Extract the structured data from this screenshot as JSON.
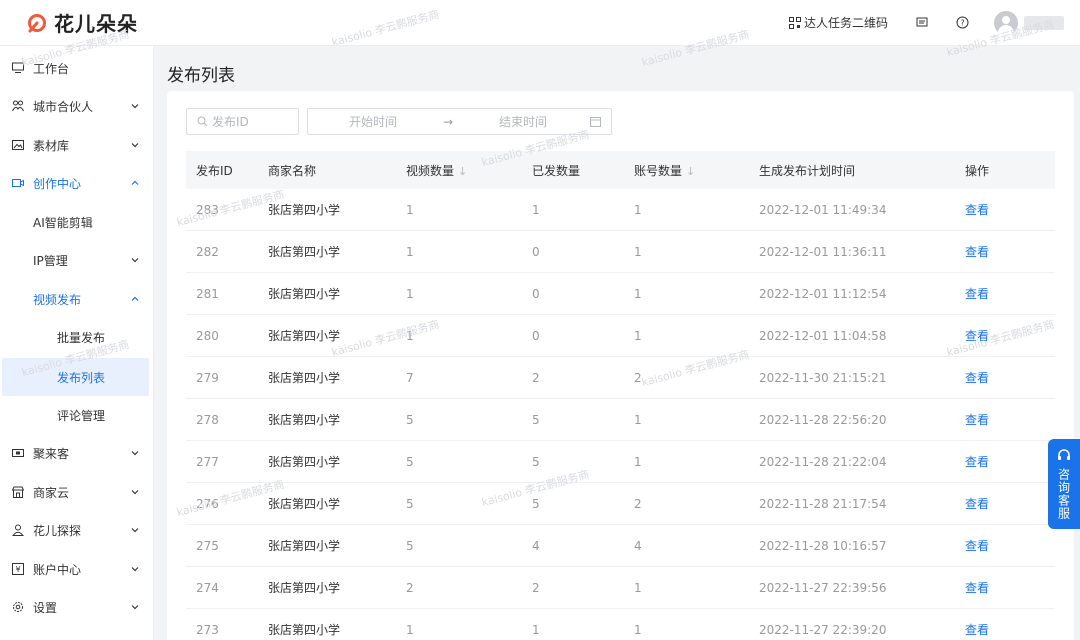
{
  "brand": {
    "name": "花儿朵朵",
    "color": "#f05a3c"
  },
  "header": {
    "qr_label": "达人任务二维码",
    "icons": [
      "qr-icon",
      "message-icon",
      "help-icon"
    ]
  },
  "sidebar": {
    "items": [
      {
        "label": "工作台",
        "icon": "monitor-icon"
      },
      {
        "label": "城市合伙人",
        "icon": "partners-icon"
      },
      {
        "label": "素材库",
        "icon": "image-icon"
      },
      {
        "label": "创作中心",
        "icon": "video-icon"
      },
      {
        "label": "AI智能剪辑"
      },
      {
        "label": "IP管理"
      },
      {
        "label": "视频发布"
      },
      {
        "label": "批量发布"
      },
      {
        "label": "发布列表"
      },
      {
        "label": "评论管理"
      },
      {
        "label": "聚来客",
        "icon": "ticket-icon"
      },
      {
        "label": "商家云",
        "icon": "store-icon"
      },
      {
        "label": "花儿探探",
        "icon": "explore-icon"
      },
      {
        "label": "账户中心",
        "icon": "account-icon"
      },
      {
        "label": "设置",
        "icon": "settings-icon"
      }
    ]
  },
  "main": {
    "title": "发布列表",
    "search_placeholder": "发布ID",
    "date_start_placeholder": "开始时间",
    "date_arrow": "→",
    "date_end_placeholder": "结束时间",
    "columns": [
      "发布ID",
      "商家名称",
      "视频数量",
      "已发数量",
      "账号数量",
      "生成发布计划时间",
      "操作"
    ],
    "sort_symbol": "↓",
    "rows": [
      [
        "283",
        "张店第四小学",
        "1",
        "1",
        "1",
        "2022-12-01 11:49:34",
        "查看"
      ],
      [
        "282",
        "张店第四小学",
        "1",
        "0",
        "1",
        "2022-12-01 11:36:11",
        "查看"
      ],
      [
        "281",
        "张店第四小学",
        "1",
        "0",
        "1",
        "2022-12-01 11:12:54",
        "查看"
      ],
      [
        "280",
        "张店第四小学",
        "1",
        "0",
        "1",
        "2022-12-01 11:04:58",
        "查看"
      ],
      [
        "279",
        "张店第四小学",
        "7",
        "2",
        "2",
        "2022-11-30 21:15:21",
        "查看"
      ],
      [
        "278",
        "张店第四小学",
        "5",
        "5",
        "1",
        "2022-11-28 22:56:20",
        "查看"
      ],
      [
        "277",
        "张店第四小学",
        "5",
        "5",
        "1",
        "2022-11-28 21:22:04",
        "查看"
      ],
      [
        "276",
        "张店第四小学",
        "5",
        "5",
        "2",
        "2022-11-28 21:17:54",
        "查看"
      ],
      [
        "275",
        "张店第四小学",
        "5",
        "4",
        "4",
        "2022-11-28 10:16:57",
        "查看"
      ],
      [
        "274",
        "张店第四小学",
        "2",
        "2",
        "1",
        "2022-11-27 22:39:56",
        "查看"
      ],
      [
        "273",
        "张店第四小学",
        "1",
        "1",
        "1",
        "2022-11-27 22:39:20",
        "查看"
      ]
    ]
  },
  "float_service": {
    "label": "咨询客服",
    "icon": "headset-icon"
  },
  "watermark": "kaisolio 李云鹏服务商",
  "colors": {
    "accent": "#1a73e8",
    "page_bg": "#f2f3f5"
  }
}
